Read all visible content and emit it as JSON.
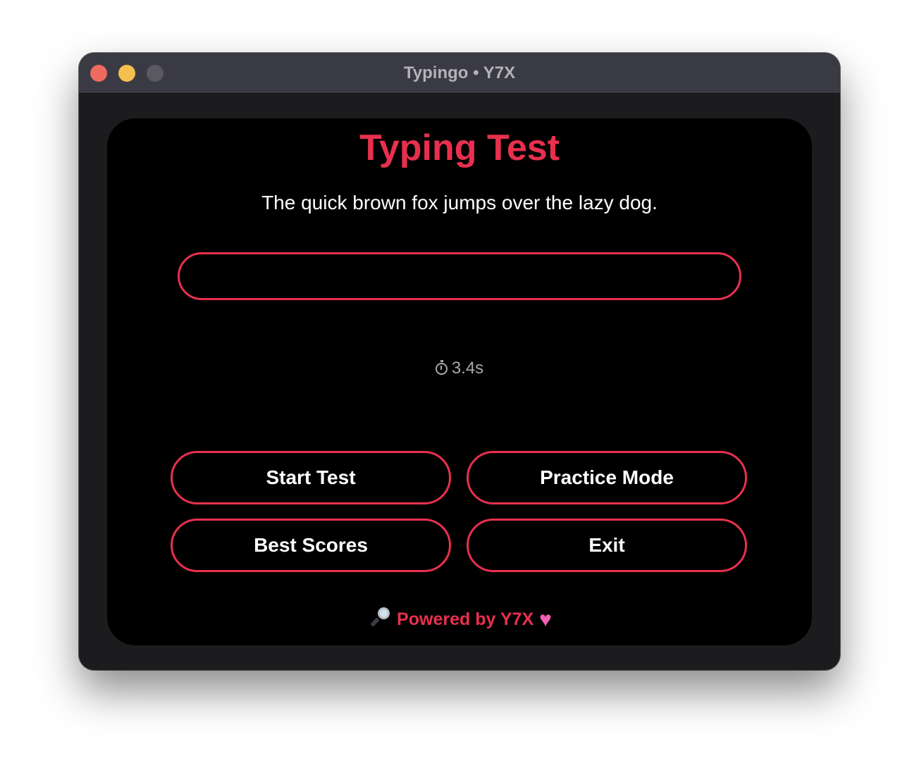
{
  "window": {
    "title": "Typingo • Y7X"
  },
  "main": {
    "heading": "Typing Test",
    "prompt_text": "The quick brown fox jumps over the lazy dog.",
    "input": {
      "value": "",
      "placeholder": ""
    },
    "timer": "3.4s"
  },
  "buttons": {
    "start_label": "Start Test",
    "practice_label": "Practice Mode",
    "scores_label": "Best Scores",
    "exit_label": "Exit"
  },
  "footer": {
    "text": "Powered by Y7X",
    "leading_icon": "magnifier-icon",
    "trailing_icon": "heart-icon"
  },
  "colors": {
    "accent": "#e8304e",
    "background": "#000000",
    "window": "#1c1c1e",
    "titlebar": "#3a3a44"
  }
}
